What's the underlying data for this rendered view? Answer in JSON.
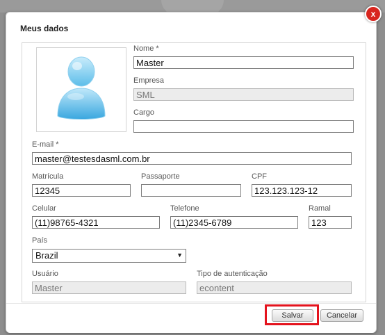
{
  "dialog": {
    "title": "Meus dados",
    "close_glyph": "x"
  },
  "form": {
    "nome": {
      "label": "Nome *",
      "value": "Master"
    },
    "empresa": {
      "label": "Empresa",
      "value": "SML"
    },
    "cargo": {
      "label": "Cargo",
      "value": ""
    },
    "email": {
      "label": "E-mail *",
      "value": "master@testesdasml.com.br"
    },
    "matricula": {
      "label": "Matrícula",
      "value": "12345"
    },
    "passaporte": {
      "label": "Passaporte",
      "value": ""
    },
    "cpf": {
      "label": "CPF",
      "value": "123.123.123-12"
    },
    "celular": {
      "label": "Celular",
      "value": "(11)98765-4321"
    },
    "telefone": {
      "label": "Telefone",
      "value": "(11)2345-6789"
    },
    "ramal": {
      "label": "Ramal",
      "value": "123"
    },
    "pais": {
      "label": "País",
      "value": "Brazil"
    },
    "usuario": {
      "label": "Usuário",
      "value": "Master"
    },
    "autenticacao": {
      "label": "Tipo de autenticação",
      "value": "econtent"
    }
  },
  "buttons": {
    "save": "Salvar",
    "cancel": "Cancelar"
  },
  "icons": {
    "avatar": "user-avatar-icon",
    "close": "close-icon",
    "dropdown": "chevron-down-icon"
  },
  "colors": {
    "close_button": "#d8261f",
    "highlight_border": "#e4131d"
  }
}
